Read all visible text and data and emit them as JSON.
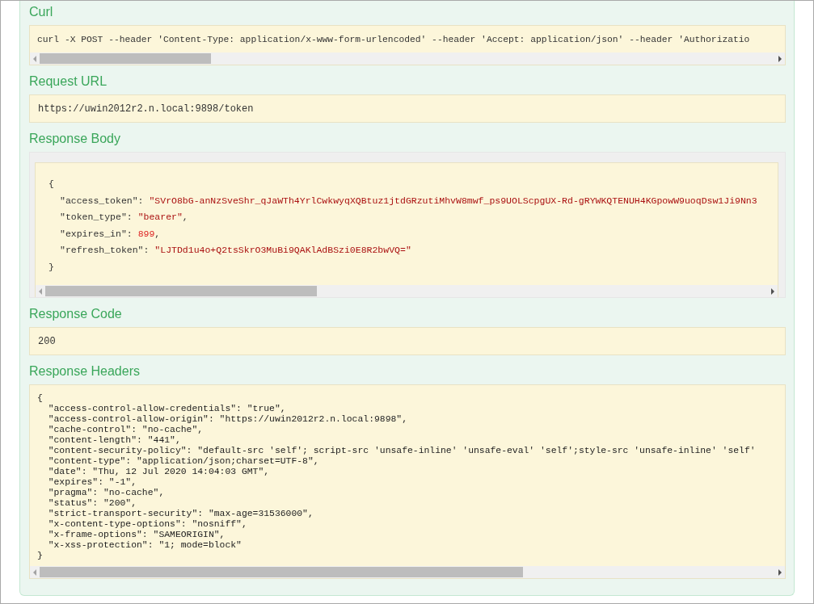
{
  "curl": {
    "title": "Curl",
    "command": "curl -X POST --header 'Content-Type: application/x-www-form-urlencoded' --header 'Accept: application/json' --header 'Authorizatio"
  },
  "request_url": {
    "title": "Request URL",
    "value": "https://uwin2012r2.n.local:9898/token"
  },
  "response_body": {
    "title": "Response Body",
    "open": "{",
    "close": "}",
    "fields": [
      {
        "key": "\"access_token\":",
        "value": "\"SVrO8bG-anNzSveShr_qJaWTh4YrlCwkwyqXQBtuz1jtdGRzutiMhvW8mwf_ps9UOLScpgUX-Rd-gRYWKQTENUH4KGpowW9uoqDsw1Ji9Nn3",
        "kind": "string"
      },
      {
        "key": "\"token_type\":",
        "value": "\"bearer\"",
        "kind": "string",
        "comma": ","
      },
      {
        "key": "\"expires_in\":",
        "value": "899",
        "kind": "number",
        "comma": ","
      },
      {
        "key": "\"refresh_token\":",
        "value": "\"LJTDd1u4o+Q2tsSkrO3MuBi9QAKlAdBSzi0E8R2bwVQ=\"",
        "kind": "string"
      }
    ]
  },
  "response_code": {
    "title": "Response Code",
    "value": "200"
  },
  "response_headers": {
    "title": "Response Headers",
    "lines": [
      "{",
      "  \"access-control-allow-credentials\": \"true\",",
      "  \"access-control-allow-origin\": \"https://uwin2012r2.n.local:9898\",",
      "  \"cache-control\": \"no-cache\",",
      "  \"content-length\": \"441\",",
      "  \"content-security-policy\": \"default-src 'self'; script-src 'unsafe-inline' 'unsafe-eval' 'self';style-src 'unsafe-inline' 'self'",
      "  \"content-type\": \"application/json;charset=UTF-8\",",
      "  \"date\": \"Thu, 12 Jul 2020 14:04:03 GMT\",",
      "  \"expires\": \"-1\",",
      "  \"pragma\": \"no-cache\",",
      "  \"status\": \"200\",",
      "  \"strict-transport-security\": \"max-age=31536000\",",
      "  \"x-content-type-options\": \"nosniff\",",
      "  \"x-frame-options\": \"SAMEORIGIN\",",
      "  \"x-xss-protection\": \"1; mode=block\"",
      "}"
    ]
  }
}
